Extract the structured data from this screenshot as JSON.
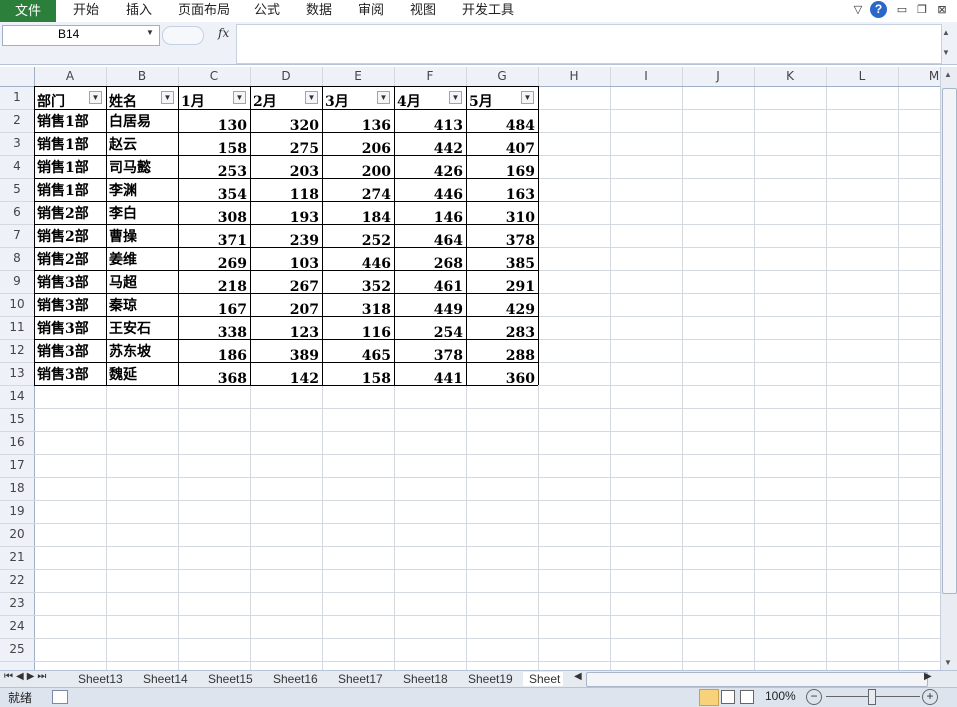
{
  "ribbon": {
    "file_tab": "文件",
    "tabs": [
      "开始",
      "插入",
      "页面布局",
      "公式",
      "数据",
      "审阅",
      "视图",
      "开发工具"
    ]
  },
  "formula_bar": {
    "name_box": "B14",
    "fx_label": "fx",
    "formula": ""
  },
  "columns": [
    "A",
    "B",
    "C",
    "D",
    "E",
    "F",
    "G",
    "H",
    "I",
    "J",
    "K",
    "L",
    "M"
  ],
  "row_numbers": [
    1,
    2,
    3,
    4,
    5,
    6,
    7,
    8,
    9,
    10,
    11,
    12,
    13,
    14,
    15,
    16,
    17,
    18,
    19,
    20,
    21,
    22,
    23,
    24,
    25
  ],
  "table": {
    "headers": [
      "部门",
      "姓名",
      "1月",
      "2月",
      "3月",
      "4月",
      "5月"
    ],
    "rows": [
      [
        "销售1部",
        "白居易",
        130,
        320,
        136,
        413,
        484
      ],
      [
        "销售1部",
        "赵云",
        158,
        275,
        206,
        442,
        407
      ],
      [
        "销售1部",
        "司马懿",
        253,
        203,
        200,
        426,
        169
      ],
      [
        "销售1部",
        "李渊",
        354,
        118,
        274,
        446,
        163
      ],
      [
        "销售2部",
        "李白",
        308,
        193,
        184,
        146,
        310
      ],
      [
        "销售2部",
        "曹操",
        371,
        239,
        252,
        464,
        378
      ],
      [
        "销售2部",
        "姜维",
        269,
        103,
        446,
        268,
        385
      ],
      [
        "销售3部",
        "马超",
        218,
        267,
        352,
        461,
        291
      ],
      [
        "销售3部",
        "秦琼",
        167,
        207,
        318,
        449,
        429
      ],
      [
        "销售3部",
        "王安石",
        338,
        123,
        116,
        254,
        283
      ],
      [
        "销售3部",
        "苏东坡",
        186,
        389,
        465,
        378,
        288
      ],
      [
        "销售3部",
        "魏延",
        368,
        142,
        158,
        441,
        360
      ]
    ]
  },
  "sheet_tabs": [
    "Sheet13",
    "Sheet14",
    "Sheet15",
    "Sheet16",
    "Sheet17",
    "Sheet18",
    "Sheet19",
    "Sheet"
  ],
  "status": {
    "ready": "就绪",
    "zoom": "100%"
  },
  "colors": {
    "file_tab": "#2b7f3a",
    "grid_line": "#d4d9e0",
    "header_bg": "#eef2f8"
  }
}
